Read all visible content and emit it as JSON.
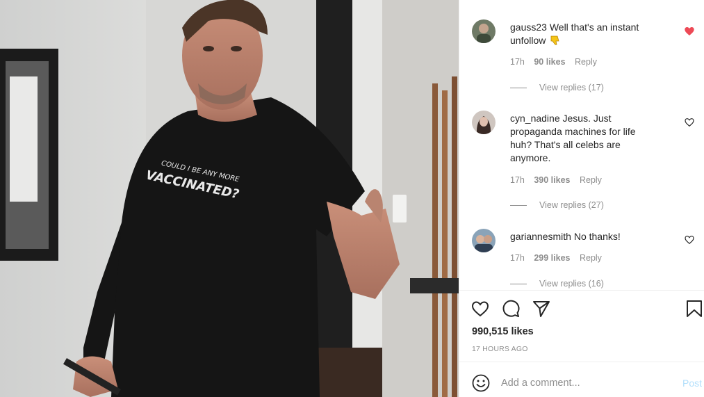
{
  "photo": {
    "alt_subject": "man-thumbs-up",
    "shirt_text_line1": "COULD I BE ANY MORE",
    "shirt_text_line2": "VACCINATED?"
  },
  "comments": [
    {
      "username": "gauss23",
      "text": "Well that's an instant unfollow",
      "emoji": "thumbs-down",
      "time": "17h",
      "likes": "90 likes",
      "reply_label": "Reply",
      "view_replies": "View replies (17)",
      "liked": true
    },
    {
      "username": "cyn_nadine",
      "text": "Jesus. Just propaganda machines for life huh? That's all celebs are anymore.",
      "time": "17h",
      "likes": "390 likes",
      "reply_label": "Reply",
      "view_replies": "View replies (27)",
      "liked": false
    },
    {
      "username": "gariannesmith",
      "text": "No thanks!",
      "time": "17h",
      "likes": "299 likes",
      "reply_label": "Reply",
      "view_replies": "View replies (16)",
      "liked": false
    }
  ],
  "actions": {
    "icons": [
      "heart-icon",
      "comment-icon",
      "share-icon",
      "save-icon"
    ],
    "likes_count": "990,515 likes",
    "posted": "17 HOURS AGO"
  },
  "add_comment": {
    "placeholder": "Add a comment...",
    "post_label": "Post"
  },
  "colors": {
    "liked_heart": "#ed4956",
    "muted_text": "#8e8e8e",
    "post_disabled": "#b2dffc"
  }
}
